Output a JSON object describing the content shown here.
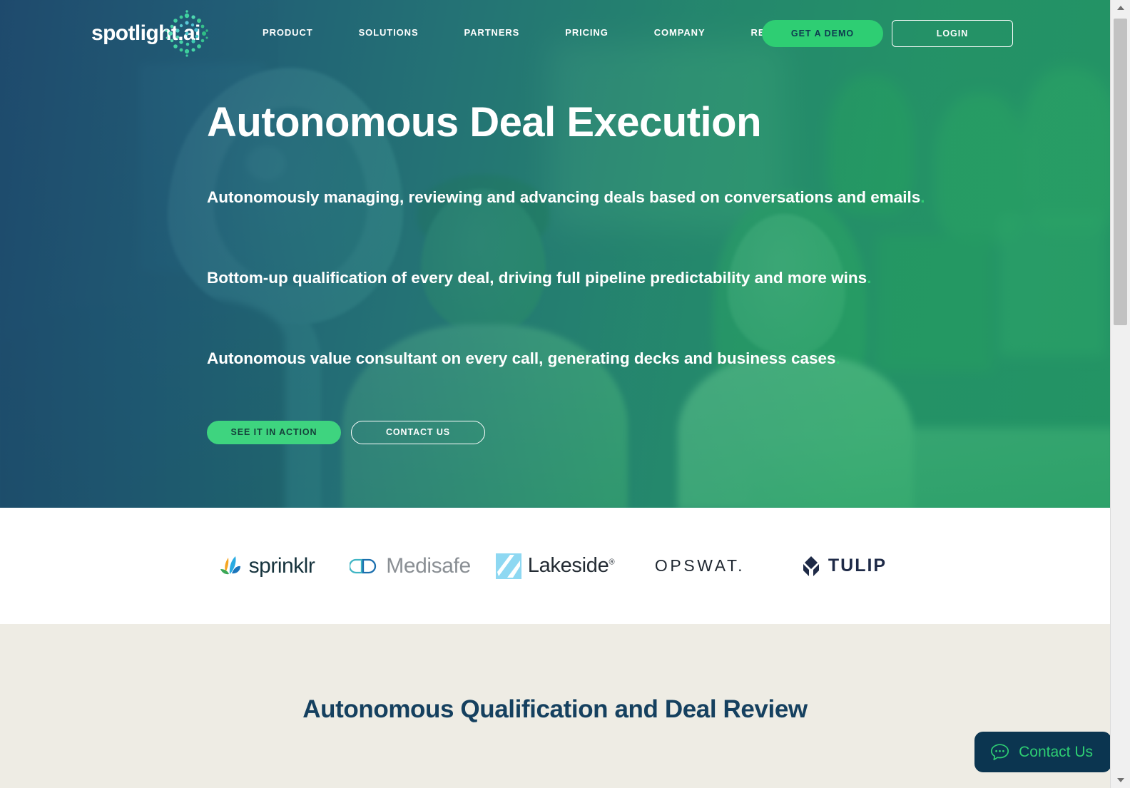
{
  "brand": {
    "logo_text": "spotlight.ai",
    "accent_green": "#2ece73",
    "navy": "#0b3550",
    "hero_gradient_from": "#1d486b",
    "hero_gradient_to": "#21a05f"
  },
  "nav": {
    "links": [
      {
        "label": "PRODUCT"
      },
      {
        "label": "SOLUTIONS"
      },
      {
        "label": "PARTNERS"
      },
      {
        "label": "PRICING"
      },
      {
        "label": "COMPANY"
      },
      {
        "label": "RESOURCES"
      }
    ],
    "demo_button": "GET A DEMO",
    "login_button": "LOGIN"
  },
  "hero": {
    "title": "Autonomous Deal Execution",
    "lines": [
      {
        "text": "Autonomously managing, reviewing and advancing deals based on conversations and emails",
        "dot": "."
      },
      {
        "text": "Bottom-up qualification of every deal, driving full pipeline predictability and more wins",
        "dot": "."
      },
      {
        "text": "Autonomous value consultant on every call, generating decks and business cases",
        "dot": "."
      }
    ],
    "primary_button": "SEE IT IN ACTION",
    "secondary_button": "CONTACT US"
  },
  "clients": {
    "sprinklr": "sprinklr",
    "medisafe": "Medisafe",
    "lakeside": "Lakeside",
    "lakeside_mark": "®",
    "opswat": "OPSWAT.",
    "tulip": "TULIP"
  },
  "section": {
    "heading": "Autonomous Qualification and Deal Review"
  },
  "contact_widget": {
    "label": "Contact Us"
  }
}
